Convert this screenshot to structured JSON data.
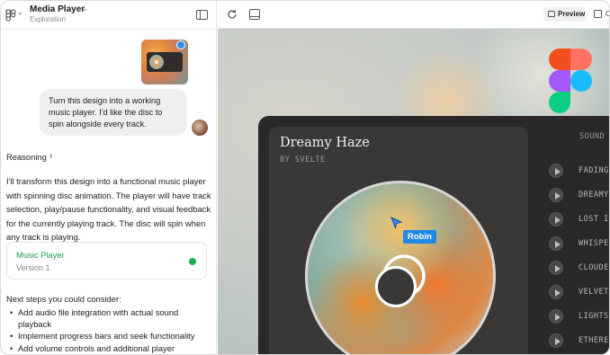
{
  "header": {
    "title": "Media Player",
    "subtitle": "Exploration"
  },
  "chat": {
    "user_message": "Turn this design into a working music player. I'd like the disc to spin alongside every track.",
    "reasoning_label": "Reasoning",
    "response": "I'll transform this design into a functional music player with spinning disc animation. The player will have track selection, play/pause functionality, and visual feedback for the currently playing track. The disc will spin when any track is playing.",
    "artifact": {
      "title": "Music Player",
      "version": "Version 1",
      "status_color": "#1fae52"
    },
    "next_steps_label": "Next steps you could consider:",
    "next_steps": [
      "Add audio file integration with actual sound playback",
      "Implement progress bars and seek functionality",
      "Add volume controls and additional player"
    ]
  },
  "toolbar": {
    "preview_label": "Preview",
    "code_label": "C"
  },
  "player": {
    "song_title": "Dreamy Haze",
    "artist": "BY SVELTE",
    "sound_label": "SOUND",
    "tracks": [
      "FADING",
      "DREAMY",
      "LOST I",
      "WHISPE",
      "CLOUDE",
      "VELVET",
      "LIGHTS",
      "ETHERE"
    ]
  },
  "cursor_label": "Robin",
  "colors": {
    "accent_green": "#1f9d55",
    "cursor_blue": "#1f8ae6",
    "player_bg": "#2a2828"
  }
}
